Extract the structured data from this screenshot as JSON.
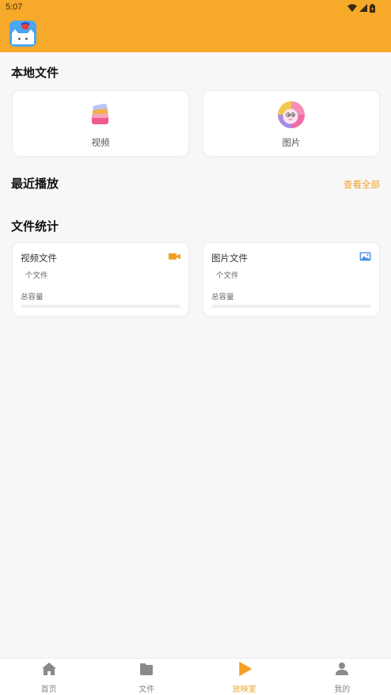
{
  "status_bar": {
    "time": "5:07"
  },
  "header": {
    "brand_color": "#f7a929"
  },
  "local_files": {
    "title": "本地文件",
    "items": [
      {
        "label": "视频",
        "icon": "video-folder-icon"
      },
      {
        "label": "图片",
        "icon": "picture-face-icon"
      }
    ]
  },
  "recent": {
    "title": "最近播放",
    "view_all": "查看全部"
  },
  "stats": {
    "title": "文件统计",
    "cards": [
      {
        "title": "视频文件",
        "count_text": "个文件",
        "capacity_label": "总容量",
        "icon": "video-camera-icon"
      },
      {
        "title": "图片文件",
        "count_text": "个文件",
        "capacity_label": "总容量",
        "icon": "image-icon"
      }
    ]
  },
  "tabs": [
    {
      "label": "首页",
      "icon": "home-icon",
      "active": false
    },
    {
      "label": "文件",
      "icon": "folder-icon",
      "active": false
    },
    {
      "label": "放映室",
      "icon": "play-icon",
      "active": true
    },
    {
      "label": "我的",
      "icon": "user-icon",
      "active": false
    }
  ],
  "colors": {
    "accent": "#f0a32a",
    "tab_inactive": "#888888"
  }
}
